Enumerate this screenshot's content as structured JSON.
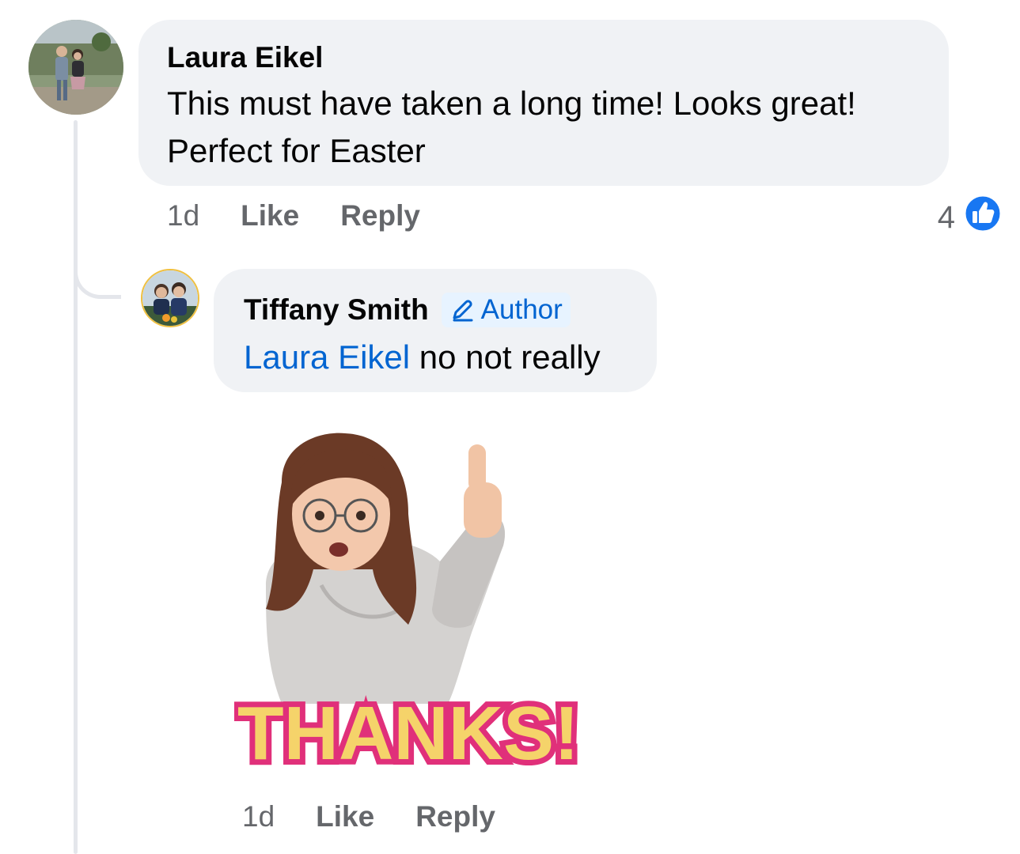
{
  "comment": {
    "author": "Laura Eikel",
    "text_line1": "This must have taken a long time! Looks great!",
    "text_line2": "Perfect for Easter",
    "time": "1d",
    "like_label": "Like",
    "reply_label": "Reply",
    "reaction_count": "4",
    "reaction_icon": "like-reaction-icon"
  },
  "reply": {
    "author": "Tiffany Smith",
    "badge_label": "Author",
    "mention": "Laura Eikel",
    "text": " no not really",
    "time": "1d",
    "like_label": "Like",
    "reply_label": "Reply",
    "sticker_text": "THANKS!"
  },
  "colors": {
    "bubble": "#f0f2f5",
    "link": "#0064d1",
    "meta": "#65676b",
    "like_blue": "#1877f2"
  }
}
